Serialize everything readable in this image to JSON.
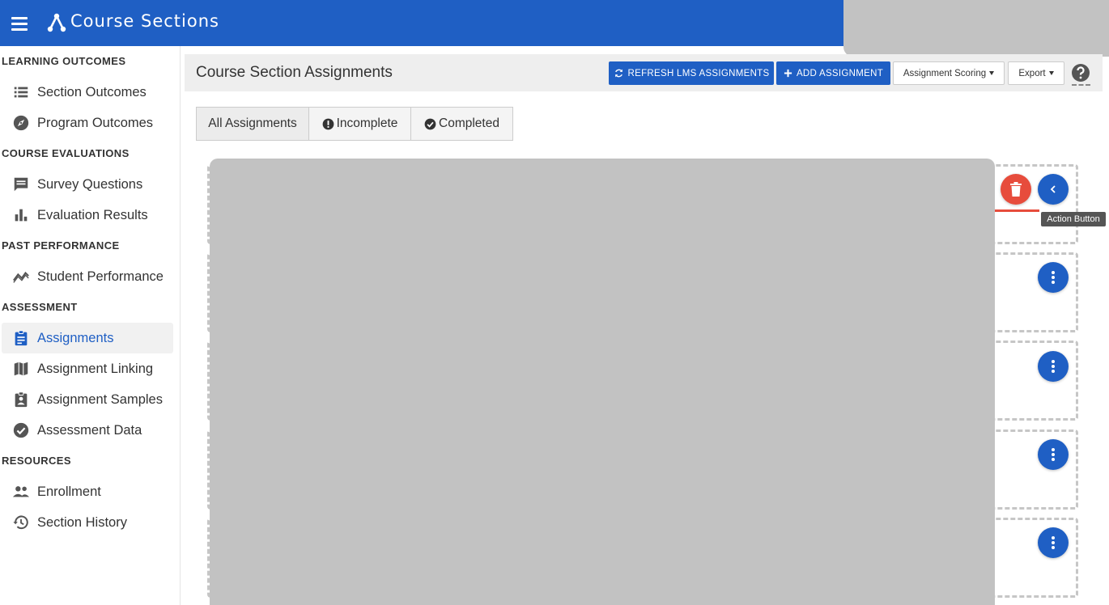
{
  "app": {
    "title": "Course Sections"
  },
  "sidebar": {
    "sections": [
      {
        "heading": "LEARNING OUTCOMES",
        "items": [
          {
            "label": "Section Outcomes",
            "icon": "list-icon"
          },
          {
            "label": "Program Outcomes",
            "icon": "compass-icon"
          }
        ]
      },
      {
        "heading": "COURSE EVALUATIONS",
        "items": [
          {
            "label": "Survey Questions",
            "icon": "comment-icon"
          },
          {
            "label": "Evaluation Results",
            "icon": "bar-chart-icon"
          }
        ]
      },
      {
        "heading": "PAST PERFORMANCE",
        "items": [
          {
            "label": "Student Performance",
            "icon": "trending-icon"
          }
        ]
      },
      {
        "heading": "ASSESSMENT",
        "items": [
          {
            "label": "Assignments",
            "icon": "clipboard-icon",
            "active": true
          },
          {
            "label": "Assignment Linking",
            "icon": "map-icon"
          },
          {
            "label": "Assignment Samples",
            "icon": "clipboard-user-icon"
          },
          {
            "label": "Assessment Data",
            "icon": "check-circle-icon"
          }
        ]
      },
      {
        "heading": "RESOURCES",
        "items": [
          {
            "label": "Enrollment",
            "icon": "people-icon"
          },
          {
            "label": "Section History",
            "icon": "history-icon"
          }
        ]
      }
    ]
  },
  "main": {
    "title": "Course Section Assignments",
    "toolbar": {
      "refresh_label": "REFRESH LMS ASSIGNMENTS",
      "add_label": "ADD ASSIGNMENT",
      "scoring_label": "Assignment Scoring",
      "export_label": "Export"
    },
    "tabs": [
      {
        "label": "All Assignments",
        "icon": ""
      },
      {
        "label": "Incomplete",
        "icon": "exclamation-circle-icon"
      },
      {
        "label": "Completed",
        "icon": "check-circle-icon"
      }
    ],
    "tooltip": "Action Button"
  },
  "colors": {
    "primary": "#1f5fc4",
    "danger": "#e74c3c",
    "placeholder": "#c2c2c2"
  }
}
